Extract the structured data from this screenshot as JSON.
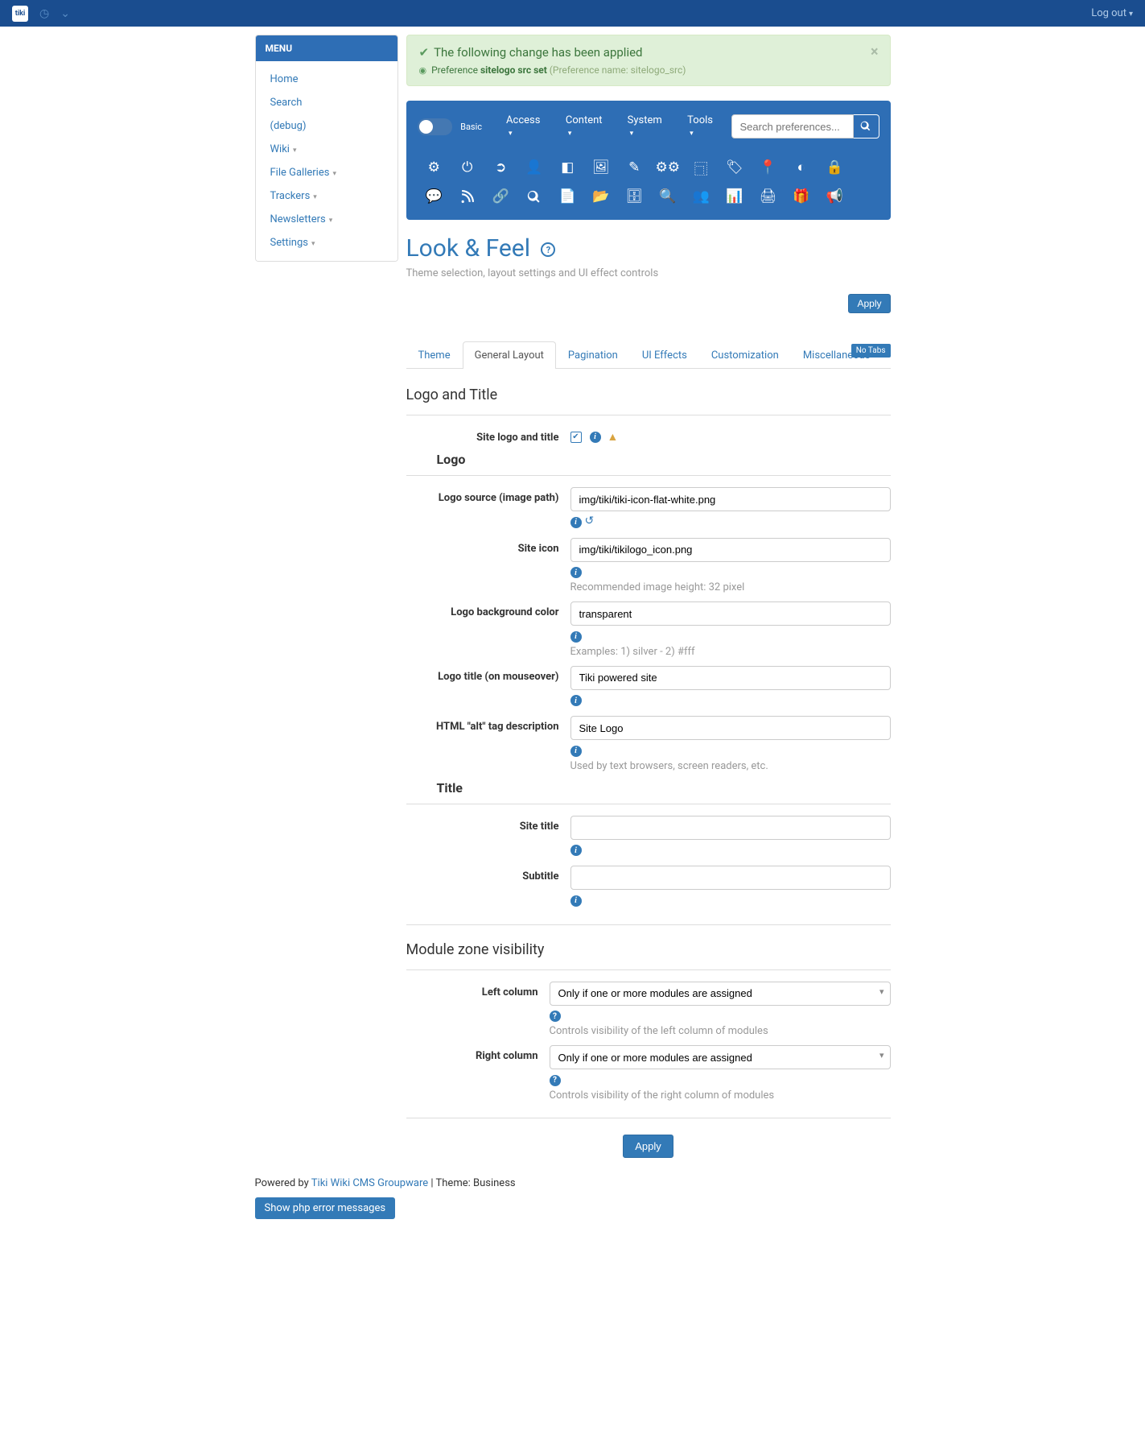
{
  "topbar": {
    "logout": "Log out"
  },
  "sidebar": {
    "menu_header": "MENU",
    "items": [
      {
        "label": "Home",
        "caret": false
      },
      {
        "label": "Search",
        "caret": false
      },
      {
        "label": "(debug)",
        "caret": false
      },
      {
        "label": "Wiki",
        "caret": true
      },
      {
        "label": "File Galleries",
        "caret": true
      },
      {
        "label": "Trackers",
        "caret": true
      },
      {
        "label": "Newsletters",
        "caret": true
      },
      {
        "label": "Settings",
        "caret": true
      }
    ]
  },
  "alert": {
    "title": "The following change has been applied",
    "pref_prefix": "Preference ",
    "pref_bold": "sitelogo src set",
    "pref_name": "(Preference name: sitelogo_src)"
  },
  "adminbar": {
    "toggle_label": "Basic",
    "dropdowns": [
      "Access",
      "Content",
      "System",
      "Tools"
    ],
    "search_placeholder": "Search preferences..."
  },
  "page": {
    "title": "Look & Feel",
    "subtitle": "Theme selection, layout settings and UI effect controls",
    "apply": "Apply",
    "notabs": "No Tabs"
  },
  "tabs": [
    "Theme",
    "General Layout",
    "Pagination",
    "UI Effects",
    "Customization",
    "Miscellaneous"
  ],
  "logo_section": {
    "heading": "Logo and Title",
    "site_logo_title_label": "Site logo and title",
    "logo_heading": "Logo",
    "title_heading": "Title",
    "logo_source_label": "Logo source (image path)",
    "logo_source_value": "img/tiki/tiki-icon-flat-white.png",
    "site_icon_label": "Site icon",
    "site_icon_value": "img/tiki/tikilogo_icon.png",
    "site_icon_hint": "Recommended image height: 32 pixel",
    "bgcolor_label": "Logo background color",
    "bgcolor_value": "transparent",
    "bgcolor_hint": "Examples: 1) silver - 2) #fff",
    "logo_title_label": "Logo title (on mouseover)",
    "logo_title_value": "Tiki powered site",
    "alt_label": "HTML \"alt\" tag description",
    "alt_value": "Site Logo",
    "alt_hint": "Used by text browsers, screen readers, etc.",
    "site_title_label": "Site title",
    "site_title_value": "",
    "subtitle_label": "Subtitle",
    "subtitle_value": ""
  },
  "module_section": {
    "heading": "Module zone visibility",
    "left_label": "Left column",
    "left_value": "Only if one or more modules are assigned",
    "left_hint": "Controls visibility of the left column of modules",
    "right_label": "Right column",
    "right_value": "Only if one or more modules are assigned",
    "right_hint": "Controls visibility of the right column of modules"
  },
  "footer": {
    "powered": "Powered by ",
    "tiki_link": "Tiki Wiki CMS Groupware",
    "theme": "  | Theme: Business",
    "php_errors": "Show php error messages"
  },
  "apply_bottom": "Apply"
}
